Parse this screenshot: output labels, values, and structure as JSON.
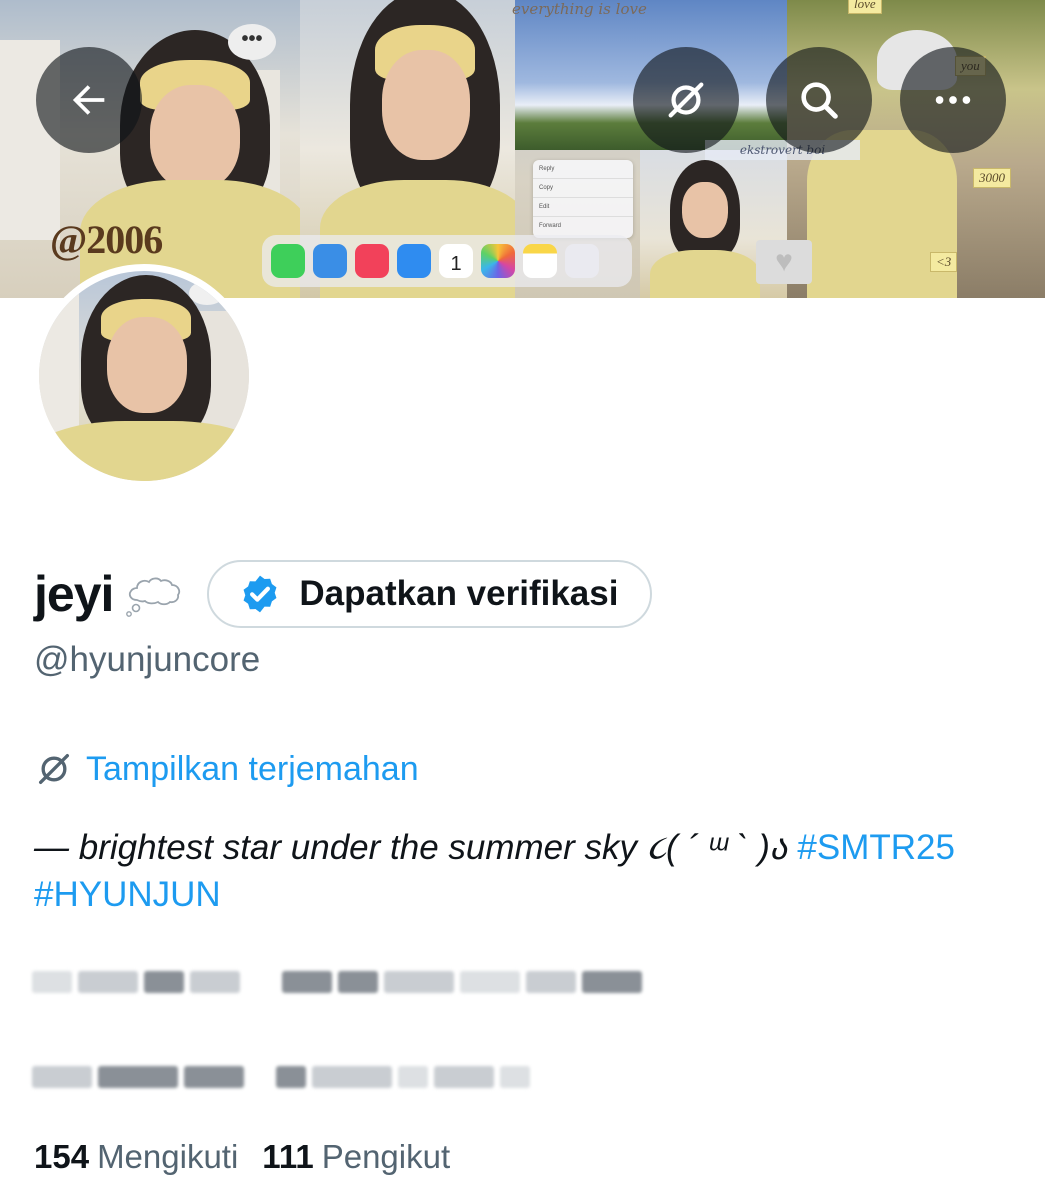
{
  "banner": {
    "overlay_tag": "@2006",
    "script_text": "everything is love",
    "sticky_note_caption": "ekstrovert boi",
    "notes": [
      "love",
      "you",
      "3000",
      "<3"
    ],
    "context_menu": [
      "Reply",
      "Copy",
      "Edit",
      "Forward"
    ],
    "dock_apps": [
      "messages-icon",
      "safari-icon",
      "music-icon",
      "mail-icon",
      "calendar-icon",
      "photos-icon",
      "notes-icon",
      "folder-icon"
    ],
    "calendar_day": "1"
  },
  "nav": {
    "back_icon": "back-arrow-icon",
    "translate_icon": "translate-icon",
    "search_icon": "search-icon",
    "more_icon": "more-icon"
  },
  "profile": {
    "display_name": "jeyi",
    "name_emoji": "thought-balloon-icon",
    "verify_label": "Dapatkan verifikasi",
    "handle": "@hyunjuncore",
    "translate_label": "Tampilkan terjemahan",
    "bio": {
      "text": "— brightest star under the summer sky ૮( ´ ᵚ ` )ა",
      "hashtags": [
        "#SMTR25",
        "#HYUNJUN"
      ]
    },
    "stats": {
      "following_count": "154",
      "following_label": "Mengikuti",
      "followers_count": "111",
      "followers_label": "Pengikut"
    }
  },
  "colors": {
    "accent": "#1d9bf0",
    "text_primary": "#0f1419",
    "text_secondary": "#536471",
    "border": "#cfd9de"
  }
}
